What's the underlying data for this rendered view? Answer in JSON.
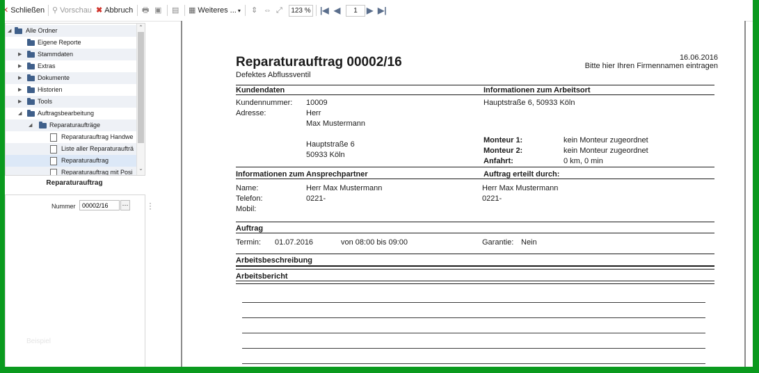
{
  "toolbar": {
    "close_label": "Schließen",
    "preview_label": "Vorschau",
    "cancel_label": "Abbruch",
    "more_label": "Weiteres ...",
    "zoom": "123 %",
    "page": "1"
  },
  "tree": {
    "items": [
      {
        "label": "Alle Ordner"
      },
      {
        "label": "Eigene Reporte"
      },
      {
        "label": "Stammdaten"
      },
      {
        "label": "Extras"
      },
      {
        "label": "Dokumente"
      },
      {
        "label": "Historien"
      },
      {
        "label": "Tools"
      },
      {
        "label": "Auftragsbearbeitung"
      },
      {
        "label": "Reparaturaufträge"
      },
      {
        "label": "Reparaturauftrag Handwe"
      },
      {
        "label": "Liste aller Reparaturaufträ"
      },
      {
        "label": "Reparaturauftrag"
      },
      {
        "label": "Reparaturauftrag mit Posi"
      }
    ]
  },
  "report_panel": {
    "title": "Reparaturauftrag",
    "number_label": "Nummer",
    "number_value": "00002/16",
    "number_button": "···",
    "watermark": "Beispiel"
  },
  "document": {
    "title": "Reparaturauftrag 00002/16",
    "subtitle": "Defektes Abflussventil",
    "date": "16.06.2016",
    "company_hint": "Bitte hier Ihren  Firmennamen eintragen",
    "kundendaten": {
      "heading": "Kundendaten",
      "customer_number_label": "Kundennummer:",
      "customer_number": "10009",
      "address_label": "Adresse:",
      "address_lines": [
        "Herr",
        "Max Mustermann",
        "Hauptstraße 6",
        "50933 Köln"
      ]
    },
    "arbeitsort": {
      "heading": "Informationen zum Arbeitsort",
      "address": "Hauptstraße 6, 50933 Köln",
      "monteur1_label": "Monteur 1:",
      "monteur1_value": "kein Monteur zugeordnet",
      "monteur2_label": "Monteur 2:",
      "monteur2_value": "kein Monteur zugeordnet",
      "anfahrt_label": "Anfahrt:",
      "anfahrt_value": "0 km, 0 min"
    },
    "ansprechpartner": {
      "heading": "Informationen zum Ansprechpartner",
      "name_label": "Name:",
      "name_value": "Herr Max Mustermann",
      "phone_label": "Telefon:",
      "phone_value": "0221-",
      "mobile_label": "Mobil:"
    },
    "erteilt": {
      "heading": "Auftrag erteilt durch:",
      "name_value": "Herr Max Mustermann",
      "phone_value": "0221-"
    },
    "auftrag": {
      "heading": "Auftrag",
      "termin_label": "Termin:",
      "termin_date": "01.07.2016",
      "termin_time": "von 08:00 bis 09:00",
      "garantie_label": "Garantie:",
      "garantie_value": "Nein"
    },
    "arbeitsbeschreibung_heading": "Arbeitsbeschreibung",
    "arbeitsbericht_heading": "Arbeitsbericht"
  }
}
